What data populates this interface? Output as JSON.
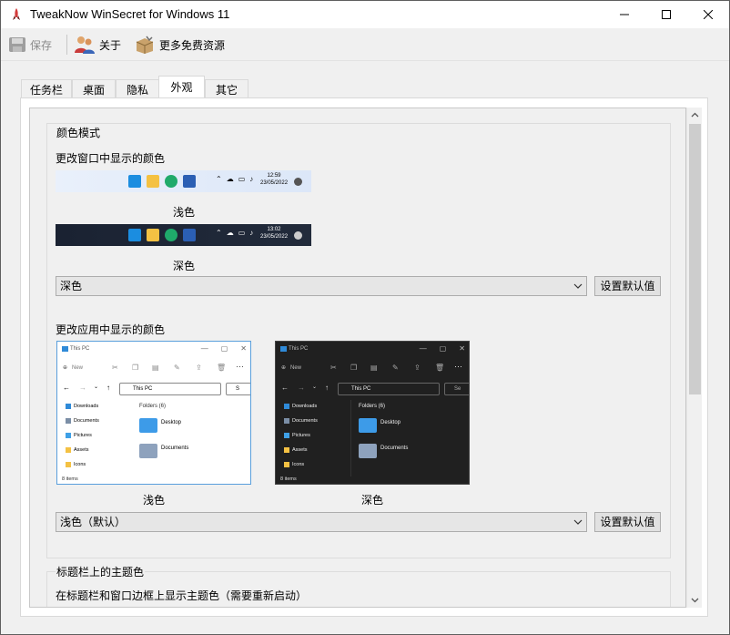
{
  "window": {
    "title": "TweakNow WinSecret for Windows 11",
    "minimize_icon": "minimize-icon",
    "maximize_icon": "maximize-icon",
    "close_icon": "close-icon"
  },
  "toolbar": {
    "save_label": "保存",
    "about_label": "关于",
    "more_label": "更多免费资源"
  },
  "tabs": [
    {
      "label": "任务栏",
      "active": false
    },
    {
      "label": "桌面",
      "active": false
    },
    {
      "label": "隐私",
      "active": false
    },
    {
      "label": "外观",
      "active": true
    },
    {
      "label": "其它",
      "active": false
    }
  ],
  "color_mode": {
    "group_title": "颜色模式",
    "windows_label": "更改窗口中显示的颜色",
    "taskbar_light": {
      "time": "12:59",
      "date": "23/05/2022",
      "caption": "浅色"
    },
    "taskbar_dark": {
      "time": "13:02",
      "date": "23/05/2022",
      "caption": "深色"
    },
    "windows_select_value": "深色",
    "windows_default_button": "设置默认值",
    "apps_label": "更改应用中显示的颜色",
    "explorer_light": {
      "title": "This PC",
      "new_label": "New",
      "address": "This PC",
      "search_placeholder": "S",
      "sidebar": [
        "Downloads",
        "Documents",
        "Pictures",
        "Assets",
        "Icons"
      ],
      "folders_header": "Folders (6)",
      "folders": [
        "Desktop",
        "Documents"
      ],
      "status": "8 items",
      "caption": "浅色"
    },
    "explorer_dark": {
      "title": "This PC",
      "new_label": "New",
      "address": "This PC",
      "search_placeholder": "Se",
      "sidebar": [
        "Downloads",
        "Documents",
        "Pictures",
        "Assets",
        "Icons"
      ],
      "folders_header": "Folders (6)",
      "folders": [
        "Desktop",
        "Documents"
      ],
      "status": "8 items",
      "caption": "深色"
    },
    "apps_select_value": "浅色（默认）",
    "apps_default_button": "设置默认值"
  },
  "accent": {
    "group_title": "标题栏上的主题色",
    "label": "在标题栏和窗口边框上显示主题色（需要重新启动）"
  },
  "colors": {
    "accent_blue": "#0078d4",
    "explorer_border": "#5a9fdc",
    "dark_bg": "#202020",
    "light_taskbar": "#dfe9f7",
    "dark_taskbar": "#1c2433"
  }
}
